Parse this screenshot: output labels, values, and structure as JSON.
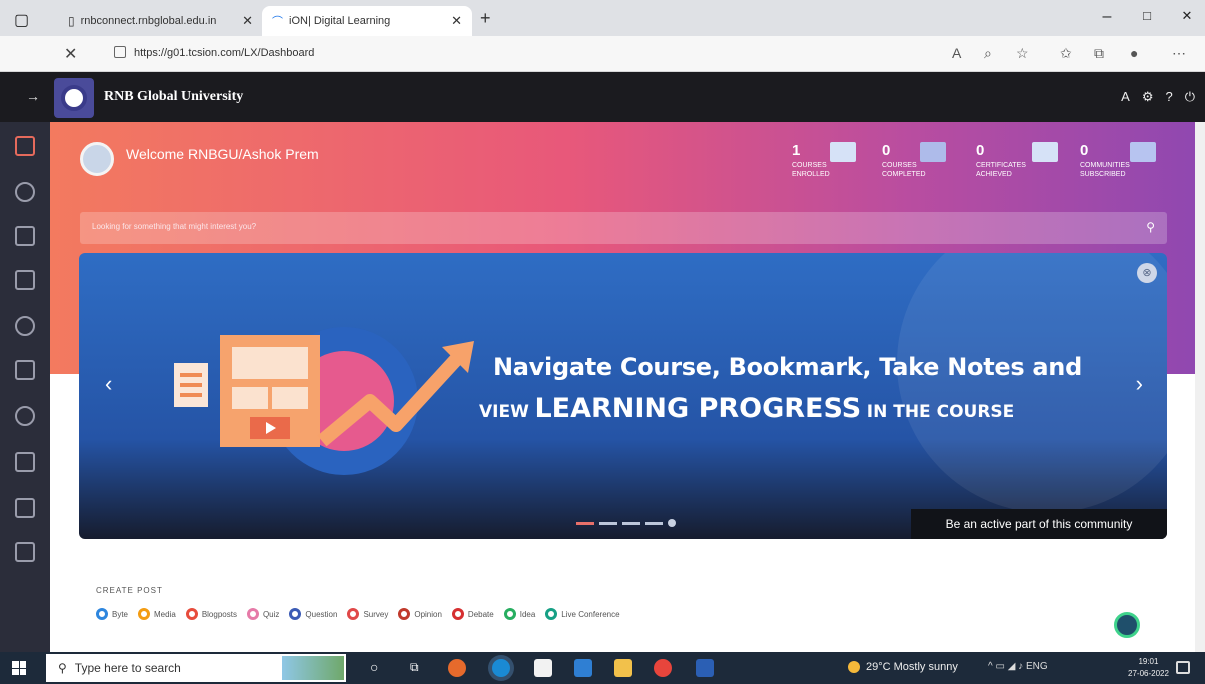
{
  "browser": {
    "tabs": [
      {
        "title": "rnbconnect.rnbglobal.edu.in",
        "active": false
      },
      {
        "title": "iON| Digital Learning",
        "active": true
      }
    ],
    "new_tab": "+",
    "url": "https://g01.tcsion.com/LX/Dashboard",
    "window_controls": [
      "–",
      "□",
      "✕"
    ]
  },
  "app": {
    "university": "RNB Global University",
    "header_right": [
      "A",
      "⚙",
      "?",
      "⏻"
    ]
  },
  "hero": {
    "welcome": "Welcome RNBGU/Ashok Prem",
    "stats": [
      {
        "count": "1",
        "label": "COURSES ENROLLED"
      },
      {
        "count": "0",
        "label": "COURSES COMPLETED"
      },
      {
        "count": "0",
        "label": "CERTIFICATES ACHIEVED"
      },
      {
        "count": "0",
        "label": "COMMUNITIES SUBSCRIBED"
      }
    ],
    "search_placeholder": "Looking for something that might interest you?"
  },
  "carousel": {
    "line1": "Navigate Course, Bookmark, Take Notes and",
    "line2_view": "VIEW",
    "line2_big": "LEARNING PROGRESS",
    "line2_end": "IN THE COURSE",
    "caption": "Be an active part of this community",
    "prev": "‹",
    "next": "›",
    "close": "⊗",
    "active_slide": 1,
    "slide_count": 5
  },
  "create_post": {
    "title": "CREATE POST",
    "items": [
      {
        "label": "Byte",
        "color": "#2e86de"
      },
      {
        "label": "Media",
        "color": "#f39c12"
      },
      {
        "label": "Blogposts",
        "color": "#e74c3c"
      },
      {
        "label": "Quiz",
        "color": "#e67aa8"
      },
      {
        "label": "Question",
        "color": "#3b5bb5"
      },
      {
        "label": "Survey",
        "color": "#e04848"
      },
      {
        "label": "Opinion",
        "color": "#c0392b"
      },
      {
        "label": "Debate",
        "color": "#d63031"
      },
      {
        "label": "Idea",
        "color": "#27ae60"
      },
      {
        "label": "Live Conference",
        "color": "#16a085"
      }
    ]
  },
  "taskbar": {
    "search_placeholder": "Type here to search",
    "weather": "29°C  Mostly sunny",
    "tray_lang": "ENG",
    "time": "19:01",
    "date": "27-06-2022"
  }
}
